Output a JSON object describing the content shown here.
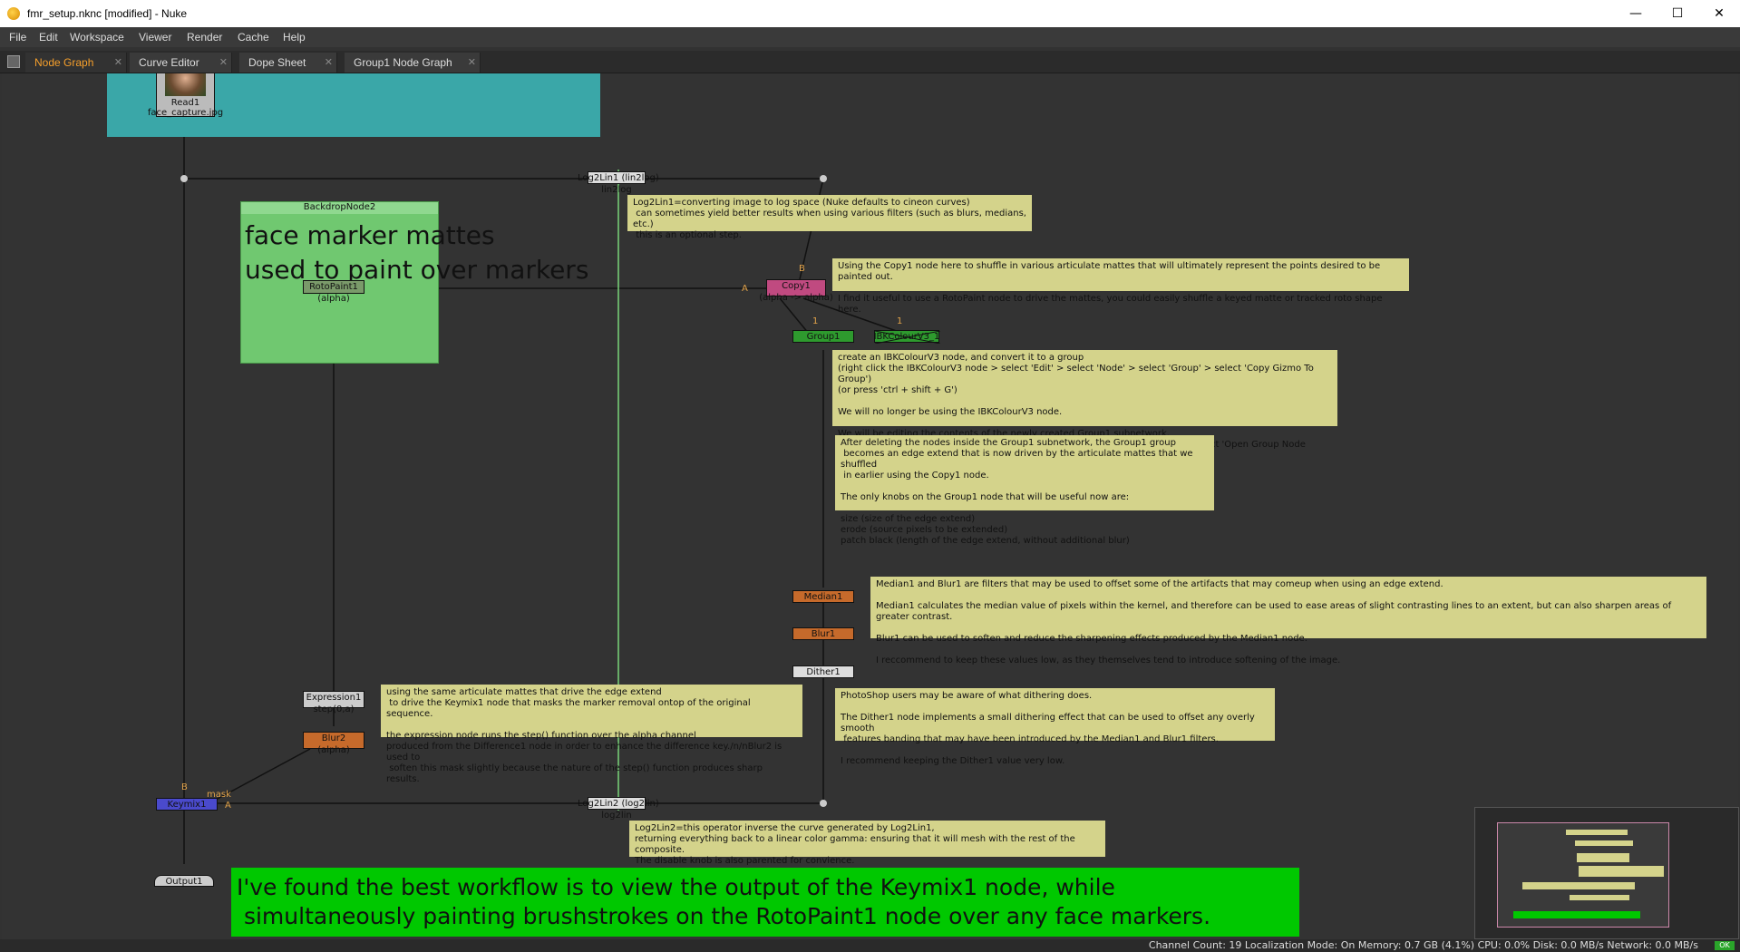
{
  "window": {
    "title": "fmr_setup.nknc [modified] - Nuke",
    "minimize": "—",
    "maximize": "☐",
    "close": "✕"
  },
  "menu": [
    "File",
    "Edit",
    "Workspace",
    "Viewer",
    "Render",
    "Cache",
    "Help"
  ],
  "tabs": [
    {
      "label": "Node Graph",
      "active": true
    },
    {
      "label": "Curve Editor"
    },
    {
      "label": "Dope Sheet"
    },
    {
      "label": "Group1 Node Graph"
    }
  ],
  "tab_close": "✕",
  "nodes": {
    "read": {
      "label": "Read1",
      "sub": "face_capture.jpg"
    },
    "log2lin1": {
      "label": "Log2Lin1 (lin2log)",
      "sub": "lin2log"
    },
    "backdrop": {
      "label": "BackdropNode2"
    },
    "backdrop_text": "face marker mattes\nused to paint over markers",
    "rotopaint": {
      "label": "RotoPaint1",
      "sub": "(alpha)"
    },
    "copy": {
      "label": "Copy1",
      "sub": "(alpha -> alpha)"
    },
    "group": {
      "label": "Group1"
    },
    "ibk": {
      "label": "IBKColourV3_1"
    },
    "median": {
      "label": "Median1"
    },
    "blur1": {
      "label": "Blur1"
    },
    "dither": {
      "label": "Dither1"
    },
    "expression": {
      "label": "Expression1",
      "sub": "step(0,a)"
    },
    "blur2": {
      "label": "Blur2",
      "sub": "(alpha)"
    },
    "keymix": {
      "label": "Keymix1"
    },
    "log2lin2": {
      "label": "Log2Lin2 (log2lin)",
      "sub": "log2lin"
    },
    "output": {
      "label": "Output1"
    }
  },
  "pins": {
    "b1": "B",
    "a1": "A",
    "one1": "1",
    "one2": "1",
    "b2": "B",
    "mask": "mask",
    "a2": "A"
  },
  "notes": {
    "log2lin1": "Log2Lin1=converting image to log space (Nuke defaults to cineon curves)\n can sometimes yield better results when using various filters (such as blurs, medians, etc.)\n this is an optional step.",
    "copy": "Using the Copy1 node here to shuffle in various articulate mattes that will ultimately represent the points desired to be painted out.\n\nI find it useful to use a RotoPaint node to drive the mattes, you could easily shuffle a keyed matte or tracked roto shape here.",
    "ibk": "create an IBKColourV3 node, and convert it to a group\n(right click the IBKColourV3 node > select 'Edit' > select 'Node' > select 'Group' > select 'Copy Gizmo To Group')\n(or press 'ctrl + shift + G')\n\nWe will no longer be using the IBKColourV3 node.\n\nWe will be editing the contents of the newly created Group1 subnetwork.\n(right click the Group1 node > select 'Edit' > select 'Node' > select 'Group' > select 'Open Group Node Graph')",
    "group": "After deleting the nodes inside the Group1 subnetwork, the Group1 group\n becomes an edge extend that is now driven by the articulate mattes that we shuffled\n in earlier using the Copy1 node.\n\nThe only knobs on the Group1 node that will be useful now are:\n\nsize (size of the edge extend)\nerode (source pixels to be extended)\npatch black (length of the edge extend, without additional blur)",
    "median": "Median1 and Blur1 are filters that may be used to offset some of the artifacts that may comeup when using an edge extend.\n\nMedian1 calculates the median value of pixels within the kernel, and therefore can be used to ease areas of slight contrasting lines to an extent, but can also sharpen areas of greater contrast.\n\nBlur1 can be used to soften and reduce the sharpening effects produced by the Median1 node.\n\nI reccommend to keep these values low, as they themselves tend to introduce softening of the image.",
    "expression": "using the same articulate mattes that drive the edge extend\n to drive the Keymix1 node that masks the marker removal ontop of the original sequence.\n\nthe expression node runs the step() function over the alpha channel\nproduced from the Difference1 node in order to enhance the difference key./n/nBlur2 is used to\n soften this mask slightly because the nature of the step() function produces sharp results.",
    "dither": "PhotoShop users may be aware of what dithering does.\n\nThe Dither1 node implements a small dithering effect that can be used to offset any overly smooth\n features banding that may have been introduced by the Median1 and Blur1 filters.\n\nI recommend keeping the Dither1 value very low.",
    "log2lin2": "Log2Lin2=this operator inverse the curve generated by Log2Lin1,\nreturning everything back to a linear color gamma: ensuring that it will mesh with the rest of the composite.\nThe disable knob is also parented for convience."
  },
  "big_note": "I've found the best workflow is to view the output of the Keymix1 node, while\n simultaneously painting brushstrokes on the RotoPaint1 node over any face markers.",
  "status": "Channel Count: 19  Localization Mode: On  Memory: 0.7 GB (4.1%)  CPU: 0.0%  Disk: 0.0 MB/s  Network: 0.0 MB/s",
  "status_ok": "OK",
  "colors": {
    "accent": "#f7a02b",
    "backdrop_teal": "#3aa7a8",
    "backdrop_green": "#70c870",
    "sticky": "#d4d38b",
    "big_note": "#00c800"
  }
}
